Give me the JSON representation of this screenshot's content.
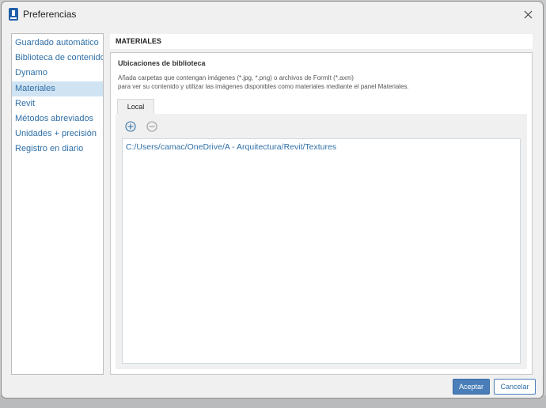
{
  "window": {
    "title": "Preferencias"
  },
  "sidebar": {
    "items": [
      {
        "label": "Guardado automático"
      },
      {
        "label": "Biblioteca de contenido"
      },
      {
        "label": "Dynamo"
      },
      {
        "label": "Materiales"
      },
      {
        "label": "Revit"
      },
      {
        "label": "Métodos abreviados"
      },
      {
        "label": "Unidades + precisión"
      },
      {
        "label": "Registro en diario"
      }
    ],
    "active_item": "Materiales"
  },
  "section": {
    "title": "MATERIALES"
  },
  "library": {
    "heading": "Ubicaciones de biblioteca",
    "description_line1": "Añada carpetas que contengan imágenes (*.jpg, *.png) o archivos de FormIt (*.axm)",
    "description_line2": "para ver su contenido y utilizar las imágenes disponibles como materiales mediante el panel Materiales.",
    "tab_label": "Local",
    "paths": [
      "C:/Users/camac/OneDrive/A - Arquitectura/Revit/Textures"
    ]
  },
  "buttons": {
    "ok": "Aceptar",
    "cancel": "Cancelar"
  },
  "icons": {
    "app": "formit-app-icon",
    "close": "close-icon",
    "add": "add-circle-icon",
    "remove": "remove-circle-icon"
  },
  "colors": {
    "accent": "#2f6fa8",
    "primary_button": "#4a7eb8",
    "selection": "#cfe3f2"
  }
}
